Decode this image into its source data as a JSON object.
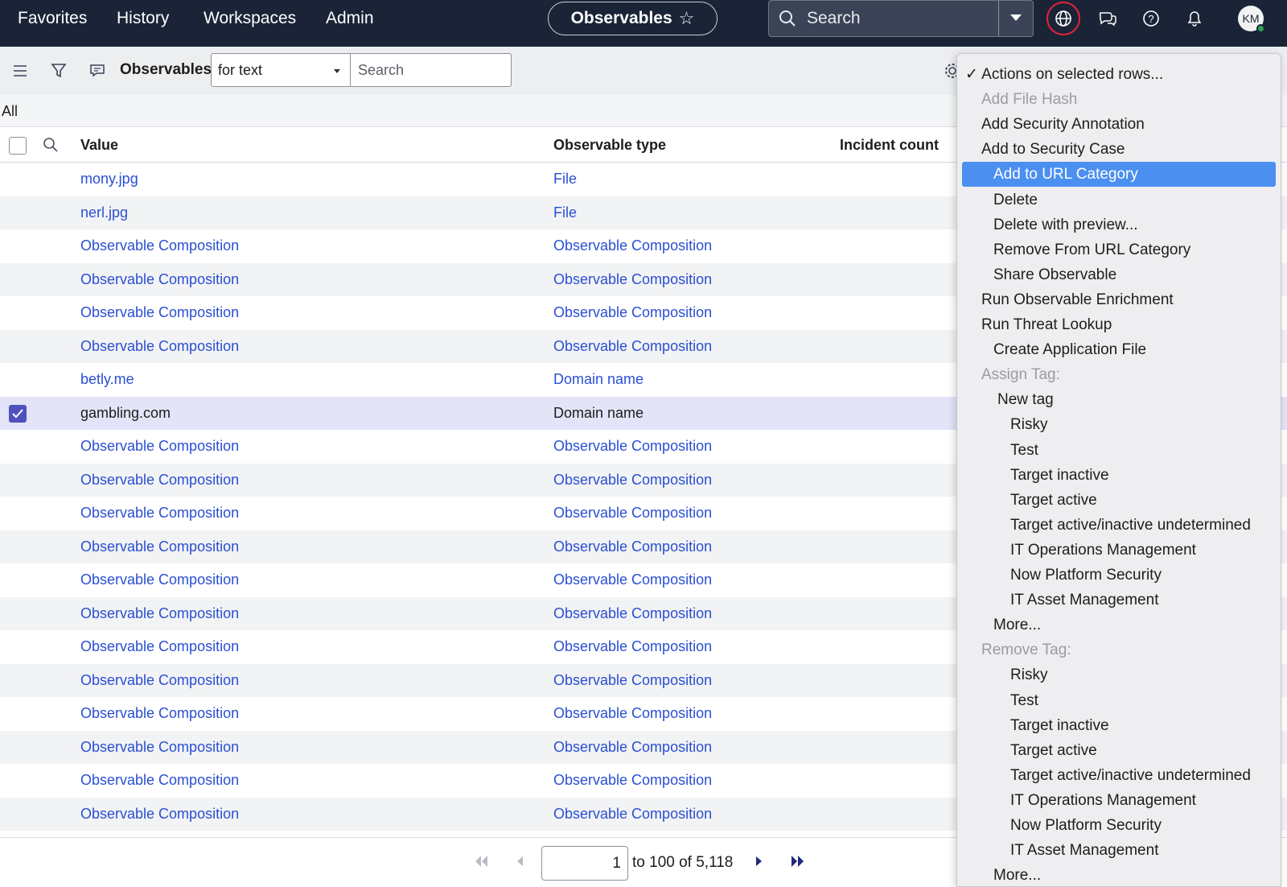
{
  "nav": {
    "links": [
      "Favorites",
      "History",
      "Workspaces",
      "Admin"
    ],
    "title": "Observables",
    "search_label": "Search",
    "avatar_initials": "KM"
  },
  "toolbar": {
    "title": "Observables",
    "filter_select": "for text",
    "search_placeholder": "Search"
  },
  "breadcrumb": "All",
  "table": {
    "columns": [
      "Value",
      "Observable type",
      "Incident count"
    ],
    "rows": [
      {
        "value": "mony.jpg",
        "type": "File",
        "selected": false
      },
      {
        "value": "nerl.jpg",
        "type": "File",
        "selected": false
      },
      {
        "value": "Observable Composition",
        "type": "Observable Composition",
        "selected": false
      },
      {
        "value": "Observable Composition",
        "type": "Observable Composition",
        "selected": false
      },
      {
        "value": "Observable Composition",
        "type": "Observable Composition",
        "selected": false
      },
      {
        "value": "Observable Composition",
        "type": "Observable Composition",
        "selected": false
      },
      {
        "value": "betly.me",
        "type": "Domain name",
        "selected": false
      },
      {
        "value": "gambling.com",
        "type": "Domain name",
        "selected": true
      },
      {
        "value": "Observable Composition",
        "type": "Observable Composition",
        "selected": false
      },
      {
        "value": "Observable Composition",
        "type": "Observable Composition",
        "selected": false
      },
      {
        "value": "Observable Composition",
        "type": "Observable Composition",
        "selected": false
      },
      {
        "value": "Observable Composition",
        "type": "Observable Composition",
        "selected": false
      },
      {
        "value": "Observable Composition",
        "type": "Observable Composition",
        "selected": false
      },
      {
        "value": "Observable Composition",
        "type": "Observable Composition",
        "selected": false
      },
      {
        "value": "Observable Composition",
        "type": "Observable Composition",
        "selected": false
      },
      {
        "value": "Observable Composition",
        "type": "Observable Composition",
        "selected": false
      },
      {
        "value": "Observable Composition",
        "type": "Observable Composition",
        "selected": false
      },
      {
        "value": "Observable Composition",
        "type": "Observable Composition",
        "selected": false
      },
      {
        "value": "Observable Composition",
        "type": "Observable Composition",
        "selected": false
      },
      {
        "value": "Observable Composition",
        "type": "Observable Composition",
        "selected": false
      }
    ]
  },
  "pagination": {
    "page": "1",
    "range_text": "to 100 of 5,118"
  },
  "actions_menu": {
    "items": [
      {
        "label": "✓ Actions on selected rows...",
        "level": 0,
        "state": "checked"
      },
      {
        "label": "Add File Hash",
        "level": 1,
        "state": "disabled"
      },
      {
        "label": "Add Security Annotation",
        "level": 1,
        "state": "normal"
      },
      {
        "label": "Add to Security Case",
        "level": 1,
        "state": "normal"
      },
      {
        "label": "Add to URL Category",
        "level": 2,
        "state": "highlighted"
      },
      {
        "label": "Delete",
        "level": 2,
        "state": "normal"
      },
      {
        "label": "Delete with preview...",
        "level": 2,
        "state": "normal"
      },
      {
        "label": "Remove From URL Category",
        "level": 2,
        "state": "normal"
      },
      {
        "label": "Share Observable",
        "level": 2,
        "state": "normal"
      },
      {
        "label": "Run Observable Enrichment",
        "level": 1,
        "state": "normal"
      },
      {
        "label": "Run Threat Lookup",
        "level": 1,
        "state": "normal"
      },
      {
        "label": "Create Application File",
        "level": 2,
        "state": "normal"
      },
      {
        "label": "Assign Tag:",
        "level": 1,
        "state": "disabled"
      },
      {
        "label": "New tag",
        "level": 3,
        "state": "normal"
      },
      {
        "label": "Risky",
        "level": 4,
        "state": "normal"
      },
      {
        "label": "Test",
        "level": 4,
        "state": "normal"
      },
      {
        "label": "Target inactive",
        "level": 4,
        "state": "normal"
      },
      {
        "label": "Target active",
        "level": 4,
        "state": "normal"
      },
      {
        "label": "Target active/inactive undetermined",
        "level": 4,
        "state": "normal"
      },
      {
        "label": "IT Operations Management",
        "level": 4,
        "state": "normal"
      },
      {
        "label": "Now Platform Security",
        "level": 4,
        "state": "normal"
      },
      {
        "label": "IT Asset Management",
        "level": 4,
        "state": "normal"
      },
      {
        "label": "More...",
        "level": 2,
        "state": "normal"
      },
      {
        "label": "Remove Tag:",
        "level": 1,
        "state": "disabled"
      },
      {
        "label": "Risky",
        "level": 4,
        "state": "normal"
      },
      {
        "label": "Test",
        "level": 4,
        "state": "normal"
      },
      {
        "label": "Target inactive",
        "level": 4,
        "state": "normal"
      },
      {
        "label": "Target active",
        "level": 4,
        "state": "normal"
      },
      {
        "label": "Target active/inactive undetermined",
        "level": 4,
        "state": "normal"
      },
      {
        "label": "IT Operations Management",
        "level": 4,
        "state": "normal"
      },
      {
        "label": "Now Platform Security",
        "level": 4,
        "state": "normal"
      },
      {
        "label": "IT Asset Management",
        "level": 4,
        "state": "normal"
      },
      {
        "label": "More...",
        "level": 2,
        "state": "normal"
      }
    ]
  },
  "colors": {
    "nav_bg": "#1b2437",
    "link": "#2a4fd3",
    "menu_highlight": "#4b8ff0",
    "selected_row": "#e3e4f7",
    "checkbox_on": "#4f52bd",
    "focus_ring": "#e2233a"
  }
}
